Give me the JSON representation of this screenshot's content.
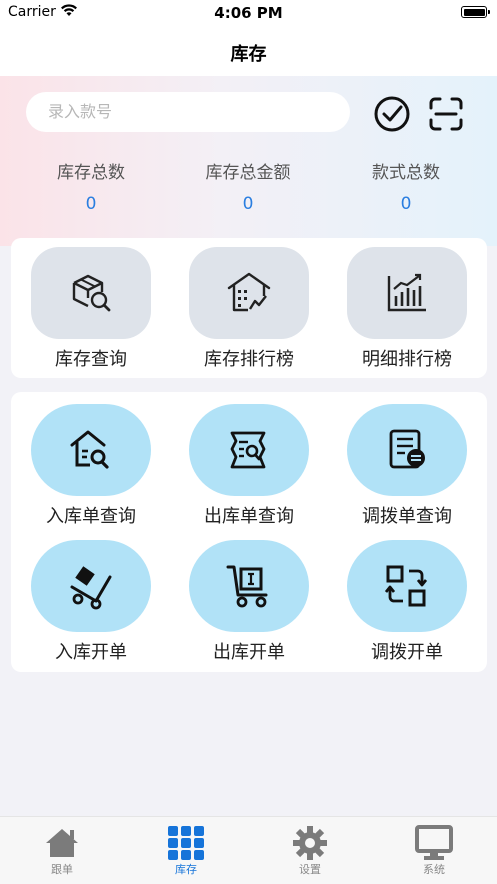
{
  "status_bar": {
    "carrier": "Carrier",
    "time": "4:06 PM"
  },
  "nav": {
    "title": "库存"
  },
  "search": {
    "placeholder": "录入款号"
  },
  "stats": [
    {
      "label": "库存总数",
      "value": "0"
    },
    {
      "label": "库存总金额",
      "value": "0"
    },
    {
      "label": "款式总数",
      "value": "0"
    }
  ],
  "reports": [
    {
      "label": "库存查询",
      "icon": "box-search-icon"
    },
    {
      "label": "库存排行榜",
      "icon": "warehouse-chart-icon"
    },
    {
      "label": "明细排行榜",
      "icon": "bar-chart-icon"
    }
  ],
  "orders": [
    {
      "label": "入库单查询",
      "icon": "house-search-icon"
    },
    {
      "label": "出库单查询",
      "icon": "document-search-icon"
    },
    {
      "label": "调拨单查询",
      "icon": "transfer-document-icon"
    },
    {
      "label": "入库开单",
      "icon": "hand-truck-icon"
    },
    {
      "label": "出库开单",
      "icon": "cart-icon"
    },
    {
      "label": "调拨开单",
      "icon": "swap-icon"
    }
  ],
  "tabs": [
    {
      "label": "跟单",
      "icon": "home-icon",
      "active": false
    },
    {
      "label": "库存",
      "icon": "grid-icon",
      "active": true
    },
    {
      "label": "设置",
      "icon": "gear-icon",
      "active": false
    },
    {
      "label": "系统",
      "icon": "monitor-icon",
      "active": false
    }
  ],
  "colors": {
    "accent": "#1674d9",
    "stat_value": "#2a7ee0",
    "tile_grey": "#dee3ea",
    "tile_blue": "#b1e2f7"
  }
}
